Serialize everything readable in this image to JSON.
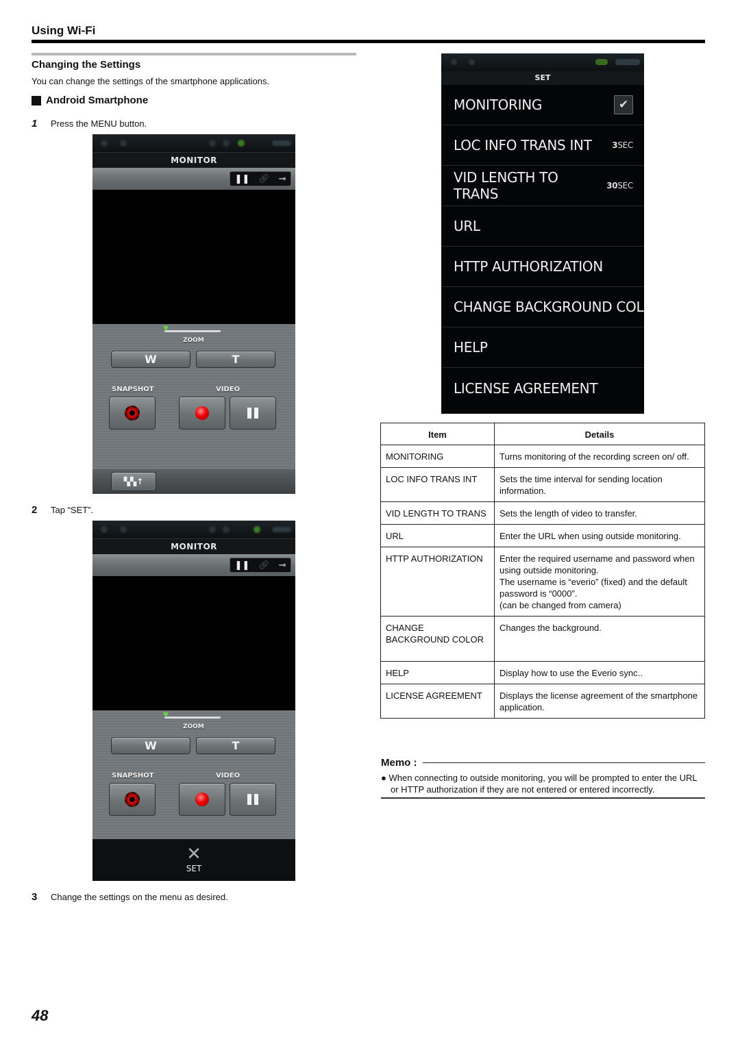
{
  "header": {
    "title": "Using Wi-Fi"
  },
  "section": {
    "title": "Changing the Settings",
    "intro": "You can change the settings of the smartphone applications.",
    "subsection": "Android Smartphone"
  },
  "steps": [
    {
      "num": "1",
      "text": "Press the MENU button."
    },
    {
      "num": "2",
      "text": "Tap “SET”."
    },
    {
      "num": "3",
      "text": "Change the settings on the menu as desired."
    }
  ],
  "monitor_screen": {
    "title": "MONITOR",
    "zoom_label": "ZOOM",
    "zoom_level": 0,
    "wide_label": "W",
    "tele_label": "T",
    "snapshot_label": "SNAPSHOT",
    "video_label": "VIDEO",
    "set_label": "SET",
    "icons": [
      "pause-icon",
      "link-icon",
      "plug-icon",
      "shutter-icon",
      "record-icon",
      "menu-icon",
      "wrench-screwdriver-icon"
    ]
  },
  "set_menu": {
    "title": "SET",
    "items": [
      {
        "label": "MONITORING",
        "checked": true
      },
      {
        "label": "LOC INFO TRANS INT",
        "value_num": "3",
        "value_unit": "SEC"
      },
      {
        "label": "VID LENGTH TO TRANS",
        "value_num": "30",
        "value_unit": "SEC"
      },
      {
        "label": "URL"
      },
      {
        "label": "HTTP AUTHORIZATION"
      },
      {
        "label": "CHANGE BACKGROUND COL"
      },
      {
        "label": "HELP"
      },
      {
        "label": "LICENSE AGREEMENT"
      }
    ]
  },
  "table": {
    "headers": [
      "Item",
      "Details"
    ],
    "rows": [
      {
        "item": "MONITORING",
        "details": [
          "Turns monitoring of the recording screen on/ off."
        ]
      },
      {
        "item": "LOC INFO TRANS INT",
        "details": [
          "Sets the time interval for sending location information."
        ]
      },
      {
        "item": "VID LENGTH TO TRANS",
        "details": [
          "Sets the length of video to transfer."
        ]
      },
      {
        "item": "URL",
        "details": [
          "Enter the URL when using outside monitoring."
        ]
      },
      {
        "item": "HTTP AUTHORIZATION",
        "details": [
          "Enter the required username and password when using outside monitoring.",
          "The username is “everio” (fixed) and the default password is “0000”.",
          "(can be changed from camera)"
        ]
      },
      {
        "item": "CHANGE BACKGROUND COLOR",
        "details": [
          "Changes the background."
        ]
      },
      {
        "item": "HELP",
        "details": [
          "Display how to use the Everio sync.."
        ]
      },
      {
        "item": "LICENSE AGREEMENT",
        "details": [
          "Displays the license agreement of the smartphone application."
        ]
      }
    ]
  },
  "memo": {
    "title": "Memo :",
    "bullets": [
      "When connecting to outside monitoring, you will be prompted to enter the URL or HTTP authorization if they are not entered or entered incorrectly."
    ]
  },
  "page_number": "48"
}
